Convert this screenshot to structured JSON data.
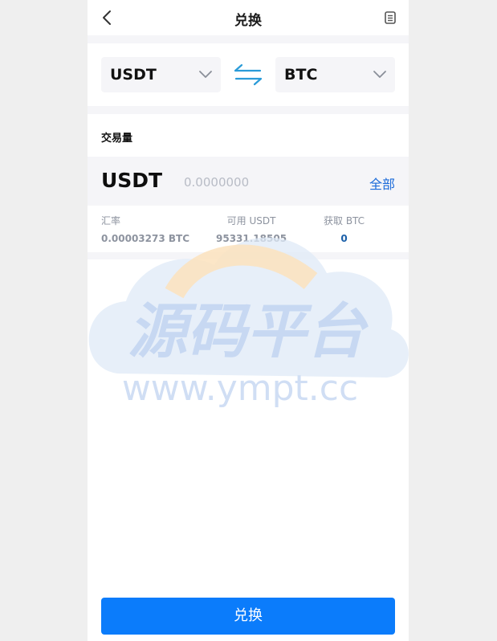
{
  "header": {
    "title": "兑换",
    "back_icon": "chevron-left-icon",
    "history_icon": "document-list-icon"
  },
  "pair": {
    "from_currency": "USDT",
    "to_currency": "BTC",
    "swap_icon": "swap-arrows-icon"
  },
  "amount": {
    "label": "交易量",
    "currency": "USDT",
    "placeholder": "0.0000000",
    "value": "",
    "all_label": "全部"
  },
  "info": {
    "rate_label": "汇率",
    "rate_value": "0.00003273 BTC",
    "available_label": "可用 USDT",
    "available_value": "95331.18505",
    "receive_label": "获取 BTC",
    "receive_value": "0"
  },
  "watermark": {
    "text_cn": "源码平台",
    "text_url": "www.ympt.cc"
  },
  "submit": {
    "label": "兑换"
  },
  "colors": {
    "primary": "#0b7cfb",
    "link": "#1a6ad9",
    "swap": "#2a9bd8",
    "panel": "#f5f5f8"
  }
}
